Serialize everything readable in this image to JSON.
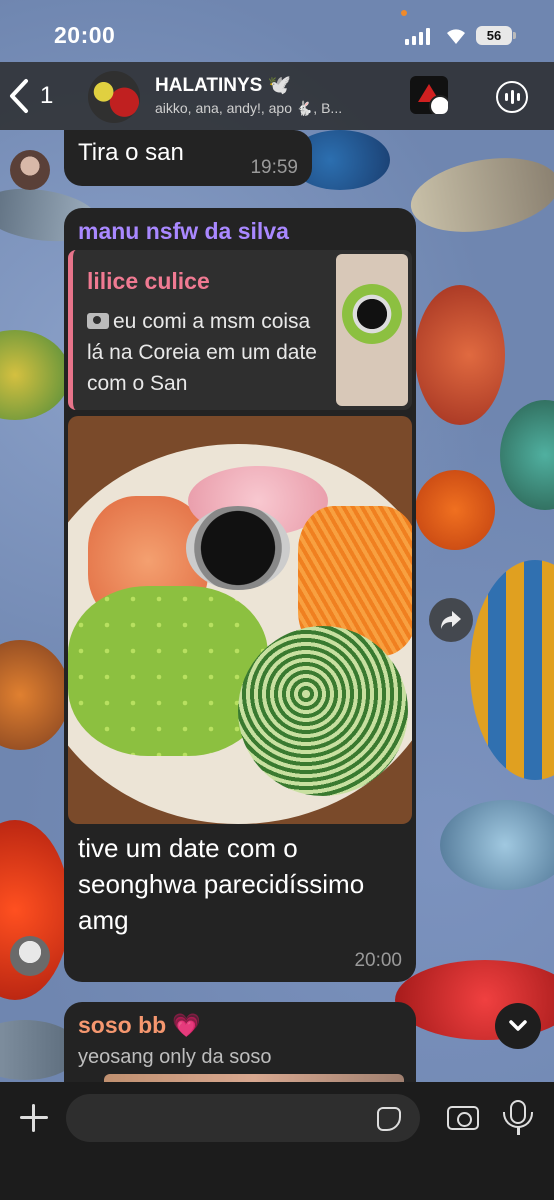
{
  "status_bar": {
    "time": "20:00",
    "battery": "56"
  },
  "header": {
    "back_count": "1",
    "group_name": "HALATINYS 🕊️",
    "members": "aikko, ana, andy!, apo 🐇, B..."
  },
  "messages": [
    {
      "id": "m1",
      "text": "Tira o san",
      "time": "19:59"
    },
    {
      "id": "m2",
      "sender": "manu nsfw da silva",
      "reply": {
        "name": "lilice culice",
        "text": "eu comi a msm coisa lá na Coreia em um date com o San",
        "icon": "camera-icon"
      },
      "text": "tive um date com o seonghwa parecidíssimo amg",
      "time": "20:00"
    },
    {
      "id": "m3",
      "sender": "soso bb",
      "sender_emoji": "💗",
      "text": "yeosang only da soso"
    }
  ],
  "composer": {
    "placeholder": ""
  },
  "colors": {
    "accent_purple": "#a988ff",
    "reply_pink": "#f07a92",
    "sender_orange": "#f5976f",
    "bubble_bg": "#232323"
  }
}
